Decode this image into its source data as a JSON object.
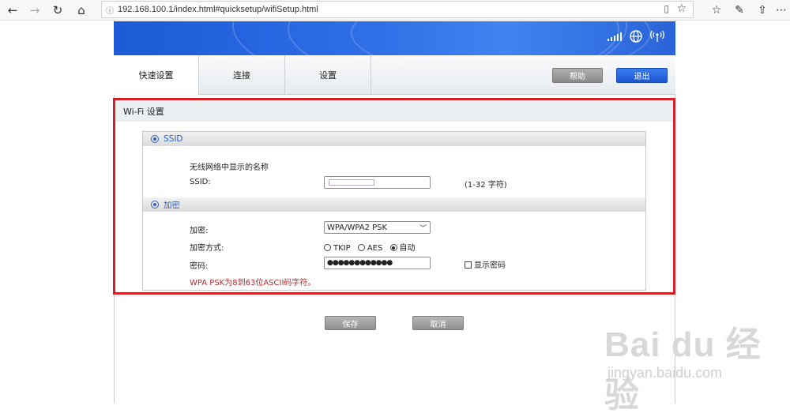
{
  "browser": {
    "url": "192.168.100.1/index.html#quicksetup/wifiSetup.html"
  },
  "tabs": [
    {
      "label": "快速设置"
    },
    {
      "label": "连接"
    },
    {
      "label": "设置"
    }
  ],
  "header_buttons": {
    "help": "帮助",
    "logout": "退出"
  },
  "section": {
    "title": "Wi-Fi 设置"
  },
  "ssid_group": {
    "title": "SSID",
    "description": "无线网络中显示的名称",
    "ssid_label": "SSID:",
    "ssid_hint": "(1-32 字符)"
  },
  "encryption_group": {
    "title": "加密",
    "encryption_label": "加密:",
    "encryption_value": "WPA/WPA2 PSK",
    "method_label": "加密方式:",
    "method_options": [
      "TKIP",
      "AES",
      "自动"
    ],
    "method_selected": "自动",
    "password_label": "密码:",
    "password_value": "●●●●●●●●●●●●",
    "show_password_label": "显示密码",
    "warning": "WPA PSK为8到63位ASCII码字符。"
  },
  "footer_buttons": {
    "save": "保存",
    "cancel": "取消"
  },
  "watermark": {
    "logo_text": "Bai du 经验",
    "url_text": "jingyan.baidu.com"
  },
  "colors": {
    "banner_blue": "#2e6ee6",
    "highlight_red": "#d32029",
    "group_title_blue": "#2f5fbf",
    "warning_red": "#b32a2a"
  }
}
